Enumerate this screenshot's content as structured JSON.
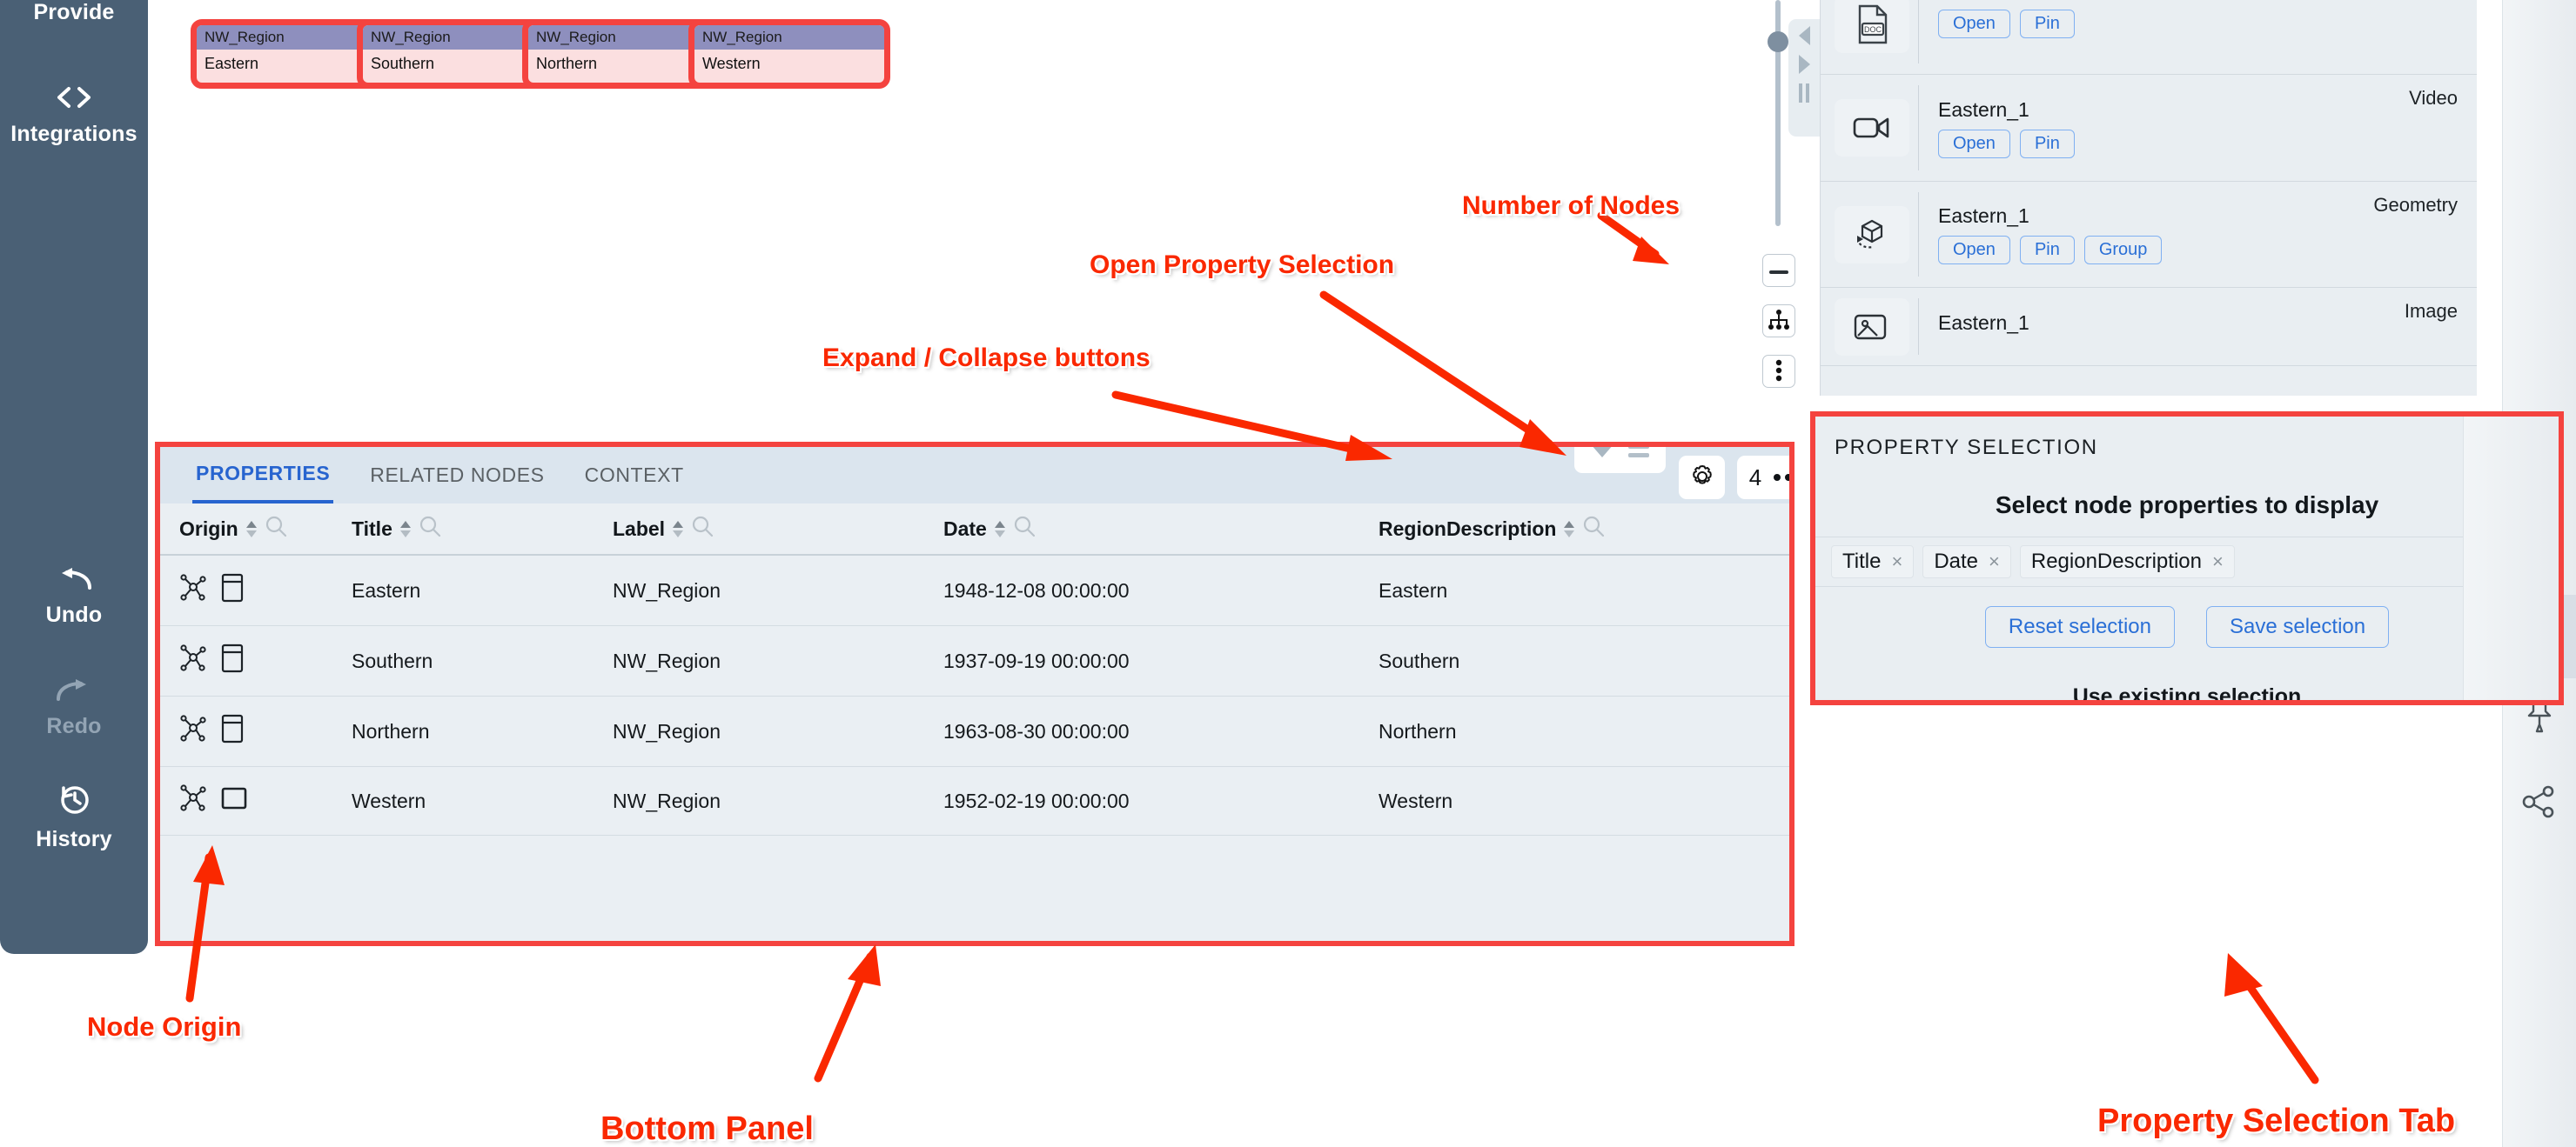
{
  "sidebar": {
    "items": [
      {
        "label": "Provide",
        "icon": "provide-icon",
        "state": "enabled"
      },
      {
        "label": "Integrations",
        "icon": "code-brackets-icon",
        "state": "enabled"
      },
      {
        "label": "Undo",
        "icon": "undo-arrow-icon",
        "state": "enabled"
      },
      {
        "label": "Redo",
        "icon": "redo-arrow-icon",
        "state": "disabled"
      },
      {
        "label": "History",
        "icon": "clock-history-icon",
        "state": "enabled"
      }
    ]
  },
  "graph": {
    "nodes": [
      {
        "header": "NW_Region",
        "body": "Eastern"
      },
      {
        "header": "NW_Region",
        "body": "Southern"
      },
      {
        "header": "NW_Region",
        "body": "Northern"
      },
      {
        "header": "NW_Region",
        "body": "Western"
      }
    ],
    "controls": {
      "zoom_out": "zoom-out-icon",
      "tree_layout": "hierarchy-layout-icon",
      "more": "more-vertical-icon",
      "collapse_left": "collapse-left-icon",
      "expand_right": "expand-right-icon",
      "drag_handle": "drag-handle-icon"
    },
    "node_colors": {
      "header": "#8e8fbe",
      "body": "#fbdfe0",
      "selection": "#f4433f"
    }
  },
  "result_list": {
    "rows": [
      {
        "title": "",
        "type": "",
        "icon": "document-doc-icon",
        "actions": [
          "Open",
          "Pin"
        ]
      },
      {
        "title": "Eastern_1",
        "type": "Video",
        "icon": "video-camera-icon",
        "actions": [
          "Open",
          "Pin"
        ]
      },
      {
        "title": "Eastern_1",
        "type": "Geometry",
        "icon": "geometry-cube-icon",
        "actions": [
          "Open",
          "Pin",
          "Group"
        ]
      },
      {
        "title": "Eastern_1",
        "type": "Image",
        "icon": "image-icon",
        "actions": []
      }
    ]
  },
  "icon_rail": {
    "items": [
      {
        "icon": "microscope-icon",
        "active": false
      },
      {
        "icon": "document-icon",
        "active": false
      },
      {
        "icon": "property-list-icon",
        "active": true
      },
      {
        "icon": "pin-icon",
        "active": false
      },
      {
        "icon": "share-nodes-icon",
        "active": false
      }
    ]
  },
  "bottom_panel": {
    "tabs": [
      {
        "label": "PROPERTIES",
        "active": true
      },
      {
        "label": "RELATED NODES",
        "active": false
      },
      {
        "label": "CONTEXT",
        "active": false
      }
    ],
    "toolbar": {
      "collapse_icon": "collapse-triangle-icon",
      "equal_icon": "equal-rows-icon",
      "gear_icon": "gear-icon",
      "node_count_left": "4",
      "node_count_right": "4",
      "node_count_separator": "more-horizontal-icon"
    },
    "table": {
      "columns": [
        "Origin",
        "Title",
        "Label",
        "Date",
        "RegionDescription"
      ],
      "rows": [
        {
          "origin_icons": [
            "graph-node-icon",
            "table-record-icon"
          ],
          "Title": "Eastern",
          "Label": "NW_Region",
          "Date": "1948-12-08 00:00:00",
          "RegionDescription": "Eastern"
        },
        {
          "origin_icons": [
            "graph-node-icon",
            "table-record-icon"
          ],
          "Title": "Southern",
          "Label": "NW_Region",
          "Date": "1937-09-19 00:00:00",
          "RegionDescription": "Southern"
        },
        {
          "origin_icons": [
            "graph-node-icon",
            "table-record-icon"
          ],
          "Title": "Northern",
          "Label": "NW_Region",
          "Date": "1963-08-30 00:00:00",
          "RegionDescription": "Northern"
        },
        {
          "origin_icons": [
            "graph-node-icon",
            "plain-record-icon"
          ],
          "Title": "Western",
          "Label": "NW_Region",
          "Date": "1952-02-19 00:00:00",
          "RegionDescription": "Western"
        }
      ]
    }
  },
  "property_selection": {
    "header": "PROPERTY SELECTION",
    "subtitle": "Select node properties to display",
    "chips": [
      {
        "label": "Title",
        "remove": "×"
      },
      {
        "label": "Date",
        "remove": "×"
      },
      {
        "label": "RegionDescription",
        "remove": "×"
      }
    ],
    "reset_label": "Reset selection",
    "save_label": "Save selection",
    "use_existing_label": "Use existing selection"
  },
  "annotations": [
    {
      "id": "number-of-nodes",
      "text": "Number of Nodes"
    },
    {
      "id": "open-property-selection",
      "text": "Open Property Selection"
    },
    {
      "id": "expand-collapse",
      "text": "Expand / Collapse buttons"
    },
    {
      "id": "node-origin",
      "text": "Node Origin"
    },
    {
      "id": "bottom-panel",
      "text": "Bottom Panel"
    },
    {
      "id": "property-selection-tab",
      "text": "Property Selection Tab"
    }
  ],
  "annotation_color": "#fa2800"
}
